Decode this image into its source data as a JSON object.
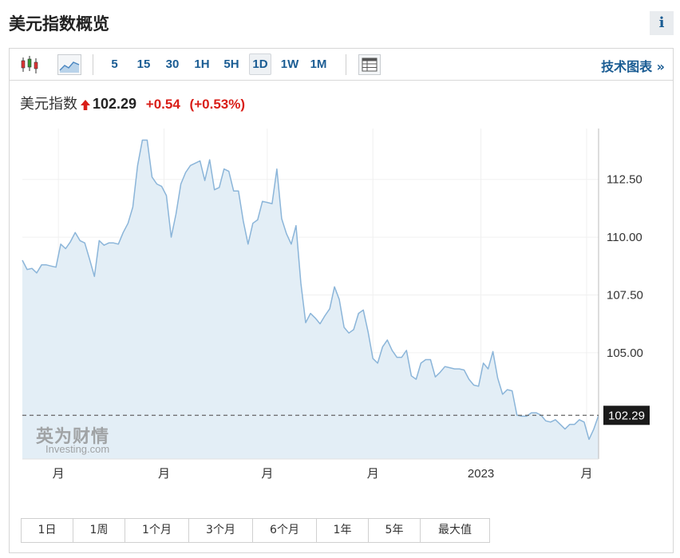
{
  "page": {
    "title": "美元指数概览",
    "info_label": "i"
  },
  "toolbar": {
    "chart_types": [
      {
        "icon": "candlestick-icon"
      },
      {
        "icon": "area-chart-icon"
      }
    ],
    "timeframes": [
      {
        "label": "5",
        "active": false
      },
      {
        "label": "15",
        "active": false
      },
      {
        "label": "30",
        "active": false
      },
      {
        "label": "1H",
        "active": false
      },
      {
        "label": "5H",
        "active": false
      },
      {
        "label": "1D",
        "active": true
      },
      {
        "label": "1W",
        "active": false
      },
      {
        "label": "1M",
        "active": false
      }
    ],
    "table_icon": "table-icon",
    "tech_label": "技术图表 »"
  },
  "quote": {
    "name": "美元指数",
    "last": "102.29",
    "change": "+0.54",
    "change_pct": "(+0.53%)",
    "direction_icon": "up-arrow-icon"
  },
  "watermark": {
    "cn": "英为财情",
    "en_main": "Investing",
    "en_suffix": ".com"
  },
  "ranges": [
    "1日",
    "1周",
    "1个月",
    "3个月",
    "6个月",
    "1年",
    "5年",
    "最大值"
  ],
  "colors": {
    "line": "#8bb5d9",
    "fill": "#e3eef6",
    "down": "#d91e18",
    "link": "#1a5c93",
    "price_tag": "#1a1a1a"
  },
  "chart_data": {
    "type": "area",
    "title": "",
    "xlabel": "",
    "ylabel": "",
    "ylim": [
      100.4,
      114.7
    ],
    "xlim": [
      0,
      120
    ],
    "y_ticks": [
      105.0,
      107.5,
      110.0,
      112.5
    ],
    "y_tick_labels": [
      "105.00",
      "107.50",
      "110.00",
      "112.50"
    ],
    "x_ticks": [
      {
        "x": 7.5,
        "label": "月"
      },
      {
        "x": 29.5,
        "label": "月"
      },
      {
        "x": 51,
        "label": "月"
      },
      {
        "x": 73,
        "label": "月"
      },
      {
        "x": 95.5,
        "label": "2023"
      },
      {
        "x": 117.5,
        "label": "月"
      }
    ],
    "grid": {
      "vertical": true,
      "horizontal": true
    },
    "current_price": {
      "value": 102.29,
      "label": "102.29"
    },
    "series": [
      {
        "x": [
          0,
          1,
          2,
          3,
          4,
          5,
          6,
          7,
          8,
          9,
          10,
          11,
          12,
          13,
          14,
          15,
          16,
          17,
          18,
          19,
          20,
          21,
          22,
          23,
          24,
          25,
          26,
          27,
          28,
          29,
          30,
          31,
          32,
          33,
          34,
          35,
          36,
          37,
          38,
          39,
          40,
          41,
          42,
          43,
          44,
          45,
          46,
          47,
          48,
          49,
          50,
          51,
          52,
          53,
          54,
          55,
          56,
          57,
          58,
          59,
          60,
          61,
          62,
          63,
          64,
          65,
          66,
          67,
          68,
          69,
          70,
          71,
          72,
          73,
          74,
          75,
          76,
          77,
          78,
          79,
          80,
          81,
          82,
          83,
          84,
          85,
          86,
          87,
          88,
          89,
          90,
          91,
          92,
          93,
          94,
          95,
          96,
          97,
          98,
          99,
          100,
          101,
          102,
          103,
          104,
          105,
          106,
          107,
          108,
          109,
          110,
          111,
          112,
          113,
          114,
          115,
          116,
          117,
          118,
          119,
          120
        ],
        "values": [
          109.0,
          108.6,
          108.65,
          108.45,
          108.8,
          108.8,
          108.75,
          108.7,
          109.7,
          109.5,
          109.8,
          110.2,
          109.85,
          109.75,
          109.05,
          108.3,
          109.85,
          109.65,
          109.75,
          109.75,
          109.7,
          110.2,
          110.6,
          111.3,
          113.1,
          114.2,
          114.2,
          112.6,
          112.3,
          112.2,
          111.8,
          110.0,
          111.0,
          112.3,
          112.8,
          113.1,
          113.2,
          113.3,
          112.45,
          113.35,
          112.05,
          112.15,
          112.95,
          112.85,
          112.0,
          112.0,
          110.7,
          109.7,
          110.6,
          110.75,
          111.55,
          111.5,
          111.45,
          112.95,
          110.8,
          110.15,
          109.7,
          110.5,
          108.0,
          106.3,
          106.7,
          106.5,
          106.25,
          106.6,
          106.9,
          107.85,
          107.3,
          106.1,
          105.85,
          106.0,
          106.7,
          106.85,
          105.9,
          104.75,
          104.55,
          105.25,
          105.55,
          105.1,
          104.8,
          104.8,
          105.1,
          104.0,
          103.85,
          104.55,
          104.7,
          104.7,
          103.95,
          104.15,
          104.4,
          104.35,
          104.3,
          104.3,
          104.25,
          103.85,
          103.6,
          103.55,
          104.55,
          104.3,
          105.05,
          103.9,
          103.2,
          103.4,
          103.35,
          102.3,
          102.25,
          102.25,
          102.4,
          102.4,
          102.3,
          102.05,
          102.0,
          102.1,
          101.9,
          101.7,
          101.9,
          101.9,
          102.1,
          102.0,
          101.25,
          101.7,
          102.29
        ]
      }
    ]
  }
}
